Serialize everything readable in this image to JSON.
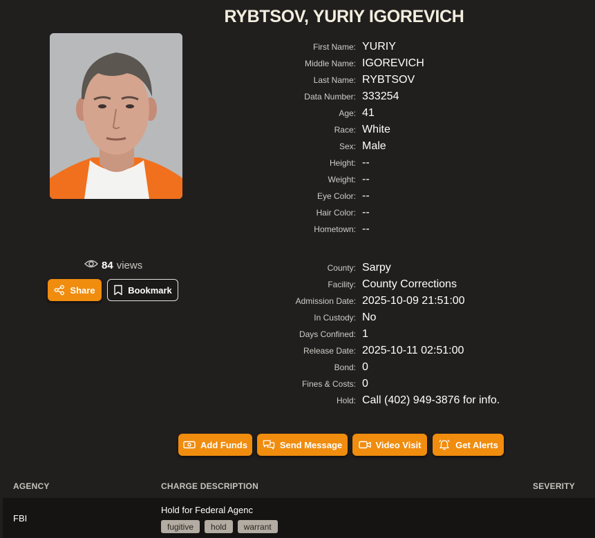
{
  "title": "RYBTSOV, YURIY IGOREVICH",
  "photo_alt": "Mugshot photo",
  "views": {
    "count": "84",
    "label": "views"
  },
  "buttons": {
    "share": "Share",
    "bookmark": "Bookmark"
  },
  "personal": [
    {
      "label": "First Name:",
      "value": "YURIY"
    },
    {
      "label": "Middle Name:",
      "value": "IGOREVICH"
    },
    {
      "label": "Last Name:",
      "value": "RYBTSOV"
    },
    {
      "label": "Data Number:",
      "value": "333254"
    },
    {
      "label": "Age:",
      "value": "41"
    },
    {
      "label": "Race:",
      "value": "White"
    },
    {
      "label": "Sex:",
      "value": "Male"
    },
    {
      "label": "Height:",
      "value": "--"
    },
    {
      "label": "Weight:",
      "value": "--"
    },
    {
      "label": "Eye Color:",
      "value": "--"
    },
    {
      "label": "Hair Color:",
      "value": "--"
    },
    {
      "label": "Hometown:",
      "value": "--"
    }
  ],
  "booking": [
    {
      "label": "County:",
      "value": "Sarpy"
    },
    {
      "label": "Facility:",
      "value": "County Corrections"
    },
    {
      "label": "Admission Date:",
      "value": "2025-10-09 21:51:00"
    },
    {
      "label": "In Custody:",
      "value": "No"
    },
    {
      "label": "Days Confined:",
      "value": "1"
    },
    {
      "label": "Release Date:",
      "value": "2025-10-11 02:51:00"
    },
    {
      "label": "Bond:",
      "value": "0"
    },
    {
      "label": "Fines & Costs:",
      "value": "0"
    },
    {
      "label": "Hold:",
      "value": "Call (402) 949-3876 for info."
    }
  ],
  "actions": {
    "add_funds": "Add Funds",
    "send_message": "Send Message",
    "video_visit": "Video Visit",
    "get_alerts": "Get Alerts"
  },
  "charges": {
    "headers": {
      "agency": "AGENCY",
      "description": "CHARGE DESCRIPTION",
      "severity": "SEVERITY"
    },
    "rows": [
      {
        "agency": "FBI",
        "description": "Hold for Federal Agenc",
        "severity": "",
        "tags": [
          "fugitive",
          "hold",
          "warrant"
        ]
      }
    ]
  },
  "colors": {
    "accent": "#f08c0e",
    "background": "#211f1e",
    "row_background": "#151413",
    "tag": "#b3aca3"
  },
  "icons": [
    "eye-icon",
    "share-icon",
    "bookmark-icon",
    "money-icon",
    "message-icon",
    "video-icon",
    "bell-icon"
  ]
}
